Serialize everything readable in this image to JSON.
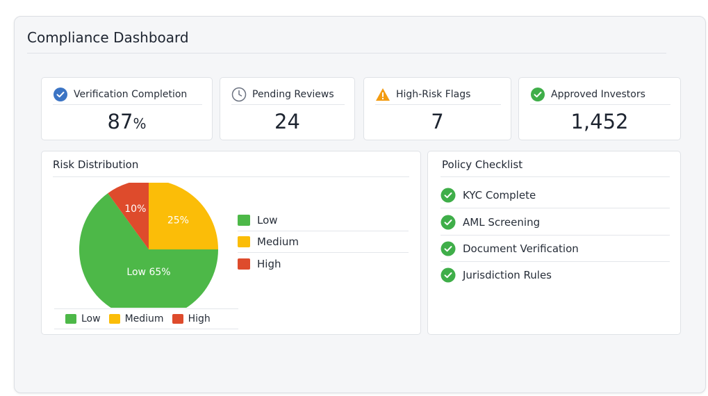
{
  "header": {
    "title": "Compliance Dashboard"
  },
  "kpis": [
    {
      "label": "Verification Completion",
      "value": "87",
      "unit": "%",
      "icon": "check-circle-icon",
      "icon_color": "#3b74c4"
    },
    {
      "label": "Pending Reviews",
      "value": "24",
      "unit": "",
      "icon": "clock-icon",
      "icon_color": "#6b7280"
    },
    {
      "label": "High-Risk Flags",
      "value": "7",
      "unit": "",
      "icon": "warning-icon",
      "icon_color": "#f39c12"
    },
    {
      "label": "Approved Investors",
      "value": "1,452",
      "unit": "",
      "icon": "check-circle-icon",
      "icon_color": "#3fae49"
    }
  ],
  "risk": {
    "title": "Risk Distribution",
    "legend": [
      "Low",
      "Medium",
      "High"
    ],
    "bottom_legend": [
      "Low",
      "Medium",
      "High"
    ]
  },
  "chart_data": {
    "type": "pie",
    "title": "Risk Distribution",
    "slices": [
      {
        "label": "Low",
        "value": 65,
        "text": "Low 65%",
        "color": "#4db848"
      },
      {
        "label": "Medium",
        "value": 25,
        "text": "25%",
        "color": "#fbbd08"
      },
      {
        "label": "High",
        "value": 10,
        "text": "10%",
        "color": "#de4b2c"
      }
    ],
    "legend_placement": "right"
  },
  "policy": {
    "title": "Policy Checklist",
    "items": [
      {
        "label": "KYC Complete",
        "icon": "check-circle-icon"
      },
      {
        "label": "AML Screening",
        "icon": "check-circle-icon"
      },
      {
        "label": "Document Verification",
        "icon": "check-circle-icon"
      },
      {
        "label": "Jurisdiction Rules",
        "icon": "check-circle-icon"
      }
    ]
  },
  "colors": {
    "low": "#4db848",
    "medium": "#fbbd08",
    "high": "#de4b2c",
    "check": "#3fae49"
  }
}
